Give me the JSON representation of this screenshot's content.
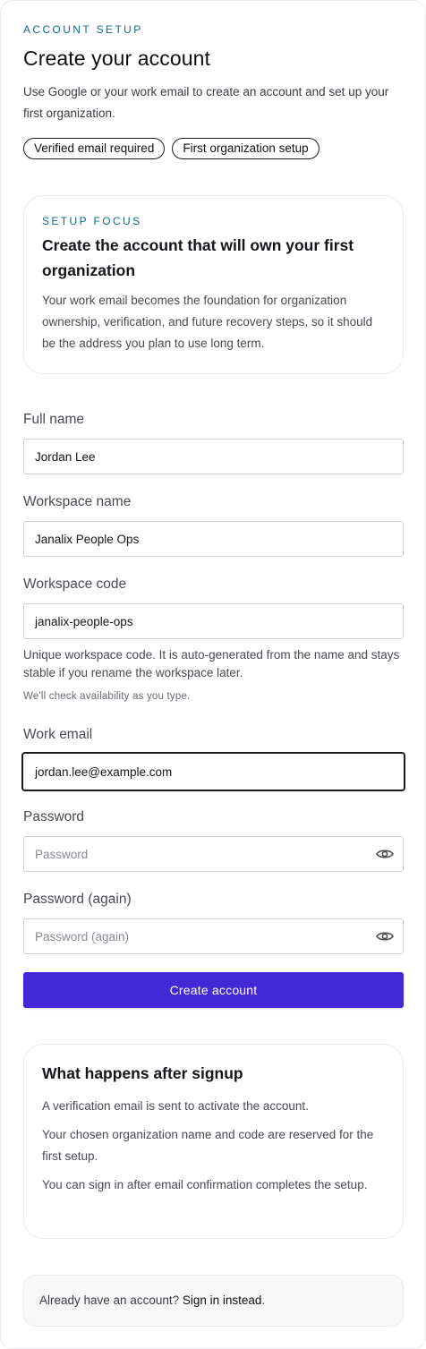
{
  "header": {
    "eyebrow": "ACCOUNT SETUP",
    "title": "Create your account",
    "subtitle": "Use Google or your work email to create an account and set up your first organization."
  },
  "chips": [
    "Verified email required",
    "First organization setup"
  ],
  "focus_card": {
    "eyebrow": "SETUP FOCUS",
    "title": "Create the account that will own your first organization",
    "body": "Your work email becomes the foundation for organization ownership, verification, and future recovery steps, so it should be the address you plan to use long term."
  },
  "form": {
    "full_name": {
      "label": "Full name",
      "value": "Jordan Lee"
    },
    "workspace_name": {
      "label": "Workspace name",
      "value": "Janalix People Ops"
    },
    "workspace_code": {
      "label": "Workspace code",
      "value": "janalix-people-ops",
      "help": "Unique workspace code. It is auto-generated from the name and stays stable if you rename the workspace later.",
      "availability_note": "We'll check availability as you type."
    },
    "work_email": {
      "label": "Work email",
      "value": "jordan.lee@example.com"
    },
    "password": {
      "label": "Password",
      "placeholder": "Password",
      "icon": "eye-icon"
    },
    "password_again": {
      "label": "Password (again)",
      "placeholder": "Password (again)",
      "icon": "eye-icon"
    },
    "submit_label": "Create account"
  },
  "after_signup": {
    "title": "What happens after signup",
    "items": [
      "A verification email is sent to activate the account.",
      "Your chosen organization name and code are reserved for the first setup.",
      "You can sign in after email confirmation completes the setup."
    ]
  },
  "signin": {
    "prompt": "Already have an account?",
    "link": "Sign in instead",
    "suffix": "."
  },
  "colors": {
    "accent": "#4328d6",
    "eyebrow": "#0f6a8f"
  }
}
